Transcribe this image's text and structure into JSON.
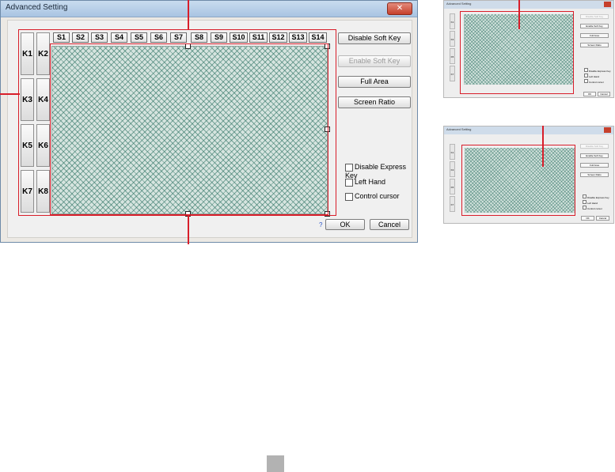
{
  "dialog": {
    "title": "Advanced Setting",
    "close_glyph": "✕",
    "soft_keys": [
      "S1",
      "S2",
      "S3",
      "S4",
      "S5",
      "S6",
      "S7",
      "S8",
      "S9",
      "S10",
      "S11",
      "S12",
      "S13",
      "S14"
    ],
    "express_keys": [
      "K1",
      "K2",
      "K3",
      "K4",
      "K5",
      "K6",
      "K7",
      "K8"
    ],
    "buttons": {
      "disable_soft_key": "Disable Soft Key",
      "enable_soft_key": "Enable Soft Key",
      "full_area": "Full Area",
      "screen_ratio": "Screen Ratio",
      "ok": "OK",
      "cancel": "Cancel"
    },
    "help_glyph": "?",
    "checkboxes": {
      "disable_express_key": "Disable Express Key",
      "left_hand": "Left Hand",
      "control_cursor": "Control cursor"
    }
  },
  "thumbnails": {
    "top": {
      "title": "Advanced Setting",
      "buttons": [
        "Disable Soft Key",
        "Enable Soft Key",
        "Full Area",
        "Screen Ratio"
      ],
      "checkboxes": [
        "Disable Express Key",
        "Left Hand",
        "Control cursor"
      ],
      "ok": "OK",
      "cancel": "Cancel",
      "keys": [
        "K1",
        "K3",
        "K5",
        "K7"
      ]
    },
    "bottom": {
      "title": "Advanced Setting",
      "buttons": [
        "Disable Soft Key",
        "Enable Soft Key",
        "Full Area",
        "Screen Ratio"
      ],
      "checkboxes": [
        "Disable Express Key",
        "Left Hand",
        "Control cursor"
      ],
      "ok": "OK",
      "cancel": "Cancel",
      "keys": [
        "K1",
        "K3",
        "K5",
        "K7"
      ]
    }
  },
  "colors": {
    "annotation": "#d81e2a",
    "active_area": "#d6e4df"
  }
}
